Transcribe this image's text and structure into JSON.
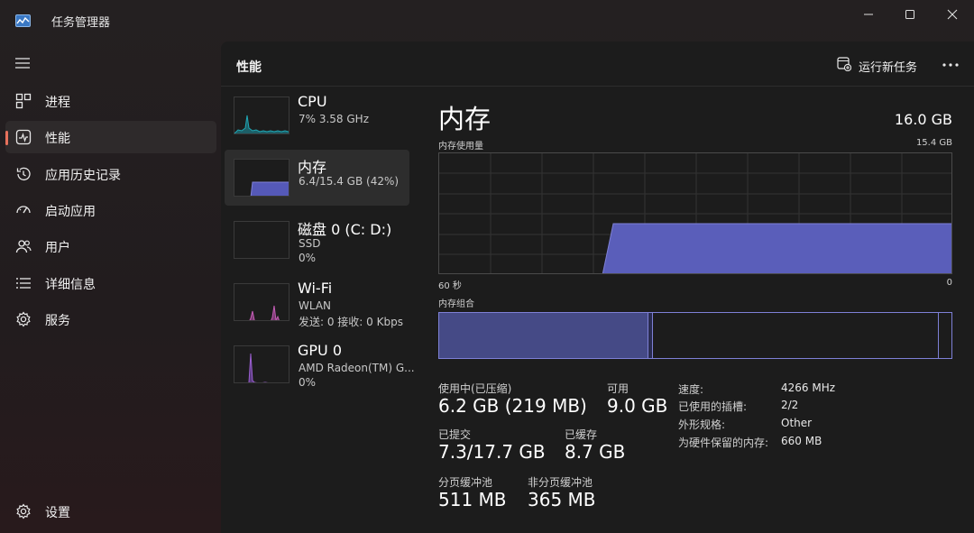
{
  "window": {
    "title": "任务管理器",
    "controls": {
      "minimize": "minimize-icon",
      "maximize": "maximize-icon",
      "close": "close-icon"
    }
  },
  "nav": {
    "items": [
      {
        "label": "进程",
        "icon": "processes-icon"
      },
      {
        "label": "性能",
        "icon": "performance-icon",
        "active": true
      },
      {
        "label": "应用历史记录",
        "icon": "app-history-icon"
      },
      {
        "label": "启动应用",
        "icon": "startup-icon"
      },
      {
        "label": "用户",
        "icon": "users-icon"
      },
      {
        "label": "详细信息",
        "icon": "details-icon"
      },
      {
        "label": "服务",
        "icon": "services-icon"
      }
    ],
    "settings": "设置"
  },
  "header": {
    "title": "性能",
    "run_new_task": "运行新任务"
  },
  "resources": [
    {
      "name": "CPU",
      "sub1": "7%  3.58 GHz",
      "sub2": "",
      "color": "#1fa7b5"
    },
    {
      "name": "内存",
      "sub1": "6.4/15.4 GB (42%)",
      "sub2": "",
      "color": "#6c70d8",
      "active": true
    },
    {
      "name": "磁盘 0 (C: D:)",
      "sub1": "SSD",
      "sub2": "0%",
      "color": "#5fa04e"
    },
    {
      "name": "Wi-Fi",
      "sub1": "WLAN",
      "sub2": "发送: 0  接收: 0 Kbps",
      "color": "#c45db6"
    },
    {
      "name": "GPU 0",
      "sub1": "AMD Radeon(TM) G...",
      "sub2": "0%",
      "color": "#9b5fd0"
    }
  ],
  "memory": {
    "title": "内存",
    "total": "16.0 GB",
    "usage_label": "内存使用量",
    "usage_max": "15.4 GB",
    "axis_left": "60 秒",
    "axis_right": "0",
    "composition_label": "内存组合",
    "usage_fraction": 0.42,
    "stats": {
      "in_use_label": "使用中(已压缩)",
      "in_use_value": "6.2 GB (219 MB)",
      "available_label": "可用",
      "available_value": "9.0 GB",
      "committed_label": "已提交",
      "committed_value": "7.3/17.7 GB",
      "cached_label": "已缓存",
      "cached_value": "8.7 GB",
      "paged_label": "分页缓冲池",
      "paged_value": "511 MB",
      "nonpaged_label": "非分页缓冲池",
      "nonpaged_value": "365 MB"
    },
    "details": [
      {
        "key": "速度:",
        "value": "4266 MHz"
      },
      {
        "key": "已使用的插槽:",
        "value": "2/2"
      },
      {
        "key": "外形规格:",
        "value": "Other"
      },
      {
        "key": "为硬件保留的内存:",
        "value": "660 MB"
      }
    ]
  },
  "colors": {
    "accent": "#e8715c",
    "memory": "#6c70d8",
    "background": "#1c1c1c"
  }
}
